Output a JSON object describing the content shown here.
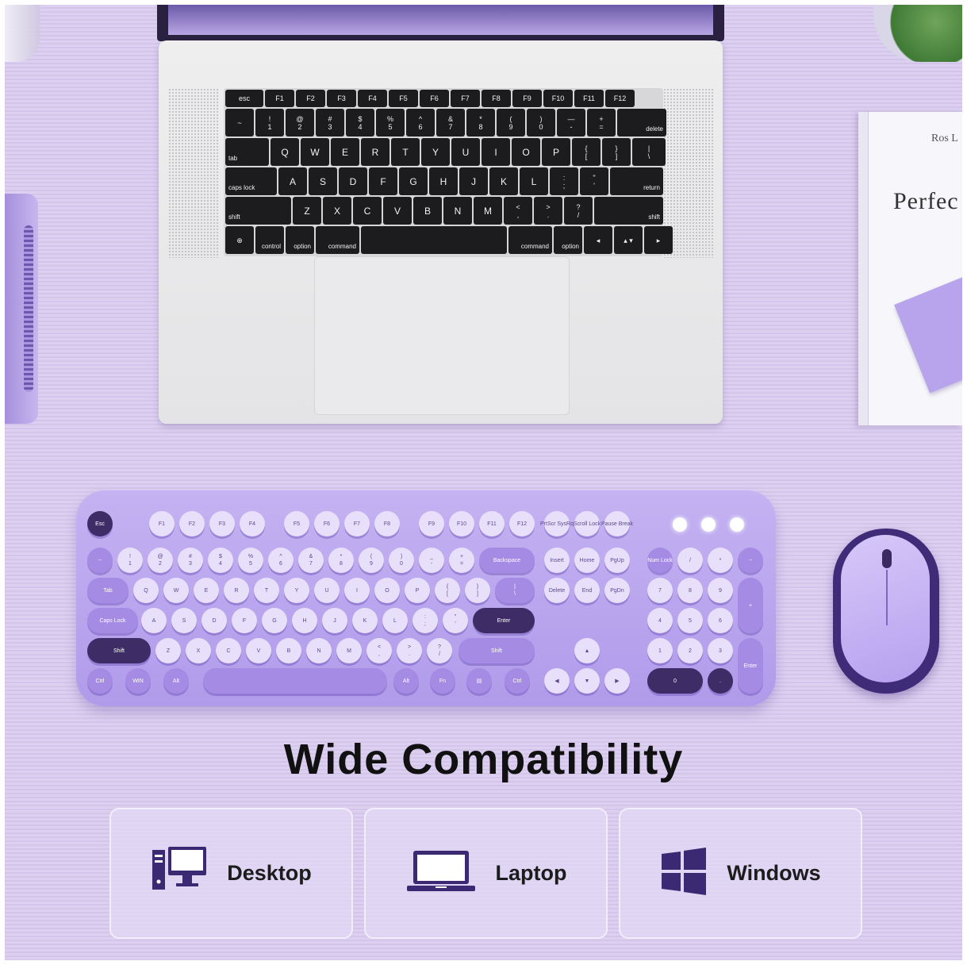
{
  "headline": "Wide Compatibility",
  "cards": [
    {
      "label": "Desktop",
      "icon": "desktop-icon"
    },
    {
      "label": "Laptop",
      "icon": "laptop-icon"
    },
    {
      "label": "Windows",
      "icon": "windows-icon"
    }
  ],
  "book": {
    "author": "Ros L",
    "title": "Perfec"
  },
  "laptop_keys": {
    "row0": [
      "esc",
      "F1",
      "F2",
      "F3",
      "F4",
      "F5",
      "F6",
      "F7",
      "F8",
      "F9",
      "F10",
      "F11",
      "F12"
    ],
    "row1": [
      "~",
      "!\n1",
      "@\n2",
      "#\n3",
      "$\n4",
      "%\n5",
      "^\n6",
      "&\n7",
      "*\n8",
      "(\n9",
      ")\n0",
      "—\n-",
      "+\n=",
      "delete"
    ],
    "row2": [
      "tab",
      "Q",
      "W",
      "E",
      "R",
      "T",
      "Y",
      "U",
      "I",
      "O",
      "P",
      "{\n[",
      "}\n]",
      "|\n\\"
    ],
    "row3": [
      "caps lock",
      "A",
      "S",
      "D",
      "F",
      "G",
      "H",
      "J",
      "K",
      "L",
      ":\n;",
      "\"\n'",
      "return"
    ],
    "row4": [
      "shift",
      "Z",
      "X",
      "C",
      "V",
      "B",
      "N",
      "M",
      "<\n,",
      ">\n.",
      "?\n/",
      "shift"
    ],
    "row5": [
      "⊕",
      "control",
      "option",
      "command",
      "",
      "command",
      "option",
      "◂",
      "▴ ▾",
      "▸"
    ]
  },
  "kb_keys": {
    "row0": [
      "Esc",
      "F1",
      "F2",
      "F3",
      "F4",
      "F5",
      "F6",
      "F7",
      "F8",
      "F9",
      "F10",
      "F11",
      "F12",
      "PrtScr SysRq",
      "Scroll Lock",
      "Pause Break"
    ],
    "row1": [
      "~",
      "!\n1",
      "@\n2",
      "#\n3",
      "$\n4",
      "%\n5",
      "^\n6",
      "&\n7",
      "*\n8",
      "(\n9",
      ")\n0",
      "_\n-",
      "+\n=",
      "Backspace",
      "Insert",
      "Home",
      "PgUp",
      "Num Lock",
      "/",
      "*",
      "−"
    ],
    "row2": [
      "Tab",
      "Q",
      "W",
      "E",
      "R",
      "T",
      "Y",
      "U",
      "I",
      "O",
      "P",
      "{\n[",
      "}\n]",
      "|\n\\",
      "Delete",
      "End",
      "PgDn",
      "7",
      "8",
      "9",
      "+"
    ],
    "row3": [
      "Caps Lock",
      "A",
      "S",
      "D",
      "F",
      "G",
      "H",
      "J",
      "K",
      "L",
      ":\n;",
      "\"\n'",
      "Enter",
      "4",
      "5",
      "6"
    ],
    "row4": [
      "Shift",
      "Z",
      "X",
      "C",
      "V",
      "B",
      "N",
      "M",
      "<\n,",
      ">\n.",
      "?\n/",
      "Shift",
      "▲",
      "1",
      "2",
      "3",
      "Enter"
    ],
    "row5": [
      "Ctrl",
      "WIN",
      "Alt",
      "",
      "Alt",
      "Fn",
      "▤",
      "Ctrl",
      "◀",
      "▼",
      "▶",
      "0",
      "."
    ]
  },
  "colors": {
    "accent": "#3d2c66",
    "keyboard": "#b9a5ef",
    "background": "#d8cbef"
  }
}
